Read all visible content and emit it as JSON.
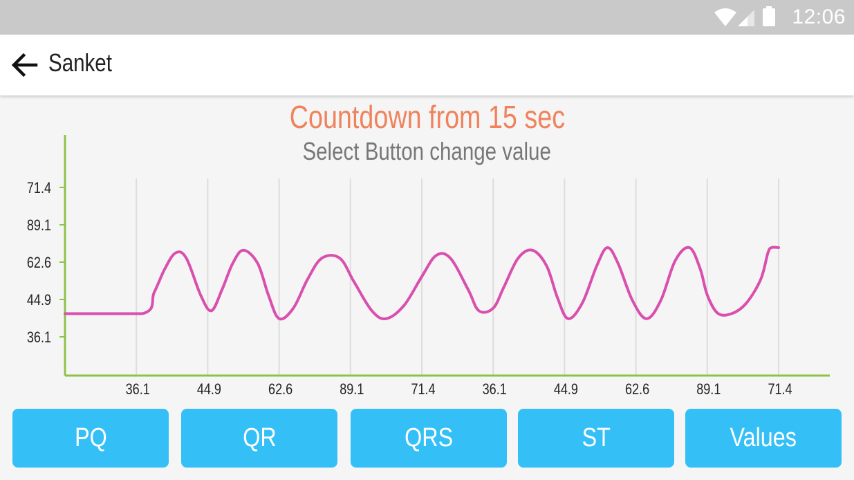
{
  "status_bar": {
    "time": "12:06",
    "icons": [
      "wifi-icon",
      "signal-icon",
      "battery-icon"
    ]
  },
  "app_bar": {
    "back_icon": "arrow-left-icon",
    "title": "Sanket"
  },
  "chart_data": {
    "type": "line",
    "title": "Countdown from 15 sec",
    "subtitle": "Select Button change value",
    "y_tick_labels": [
      "71.4",
      "89.1",
      "62.6",
      "44.9",
      "36.1"
    ],
    "x_tick_labels": [
      "36.1",
      "44.9",
      "62.6",
      "89.1",
      "71.4",
      "36.1",
      "44.9",
      "62.6",
      "89.1",
      "71.4"
    ],
    "series": [
      {
        "color": "#d94fae",
        "x": [
          0,
          1.08,
          1.25,
          1.4,
          1.55,
          1.7,
          1.9,
          2.05,
          2.2,
          2.35,
          2.5,
          2.7,
          2.85,
          3.0,
          3.2,
          3.4,
          3.6,
          3.85,
          4.05,
          4.3,
          4.5,
          4.75,
          5.0,
          5.2,
          5.4,
          5.65,
          5.8,
          6.0,
          6.15,
          6.35,
          6.55,
          6.75,
          6.9,
          7.05,
          7.25,
          7.45,
          7.6,
          7.75,
          7.95,
          8.15,
          8.35,
          8.55,
          8.75,
          8.9,
          9.0,
          9.15,
          9.35,
          9.55,
          9.75,
          9.85,
          9.9,
          10.0
        ],
        "y": [
          44.9,
          44.9,
          53,
          62,
          68,
          66,
          52,
          46,
          54,
          64,
          69,
          64,
          52,
          43,
          47,
          58,
          66,
          66,
          57,
          46,
          43,
          48,
          59,
          67,
          66,
          54,
          46,
          47,
          55,
          66,
          69,
          63,
          51,
          43,
          49,
          63,
          70,
          64,
          50,
          43,
          50,
          65,
          70,
          62,
          52,
          45,
          45,
          49,
          58,
          68,
          70,
          70
        ]
      }
    ],
    "axis_color": "#8bc34a",
    "grid": "vertical"
  },
  "buttons": [
    "PQ",
    "QR",
    "QRS",
    "ST",
    "Values"
  ]
}
